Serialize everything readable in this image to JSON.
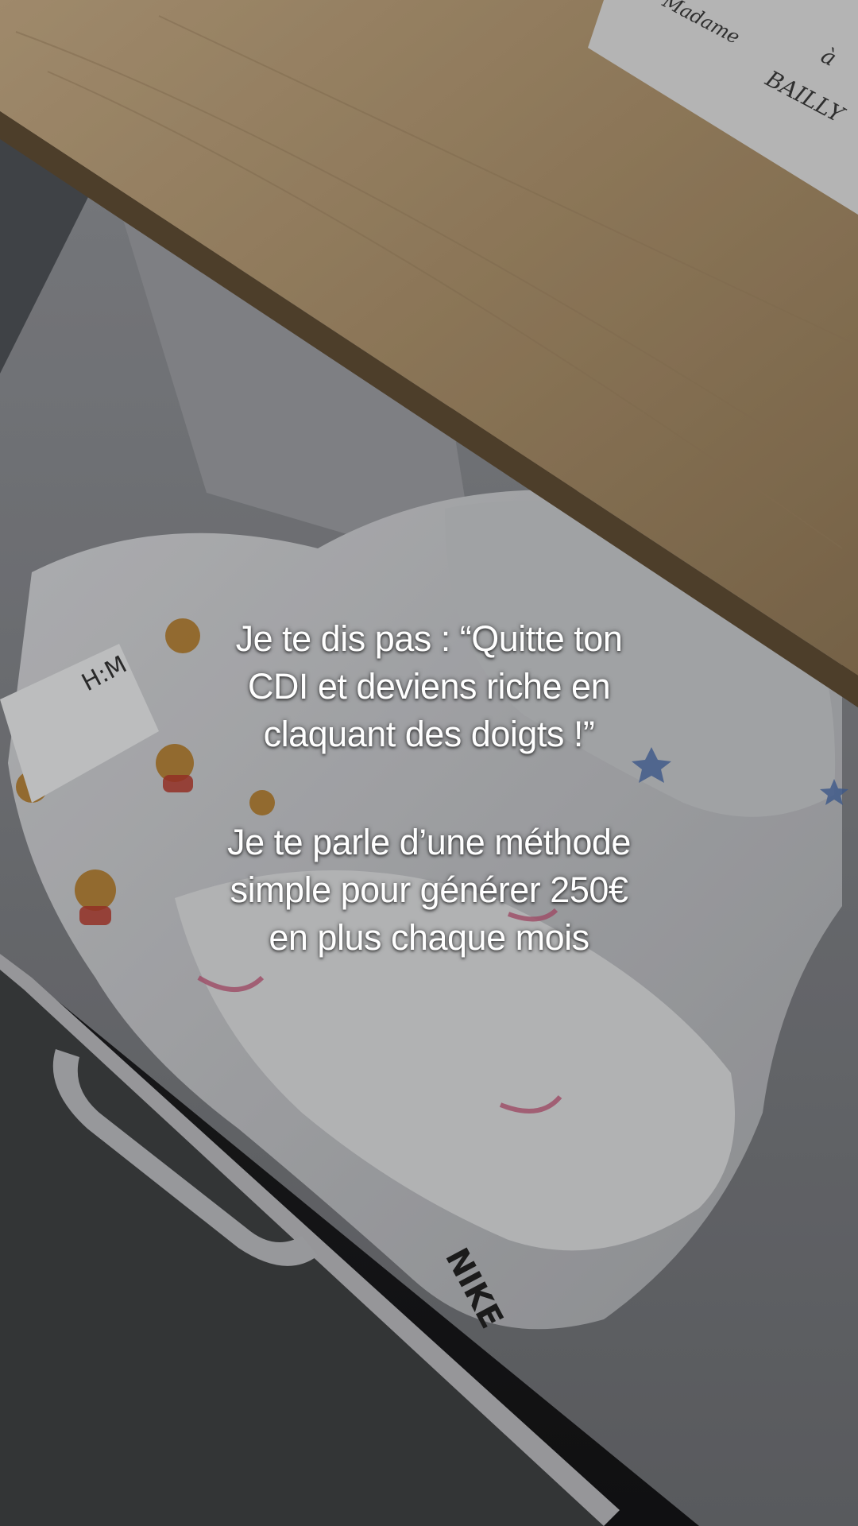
{
  "overlay": {
    "paragraph_1": {
      "lines": [
        "Je te dis pas : “Quitte ton",
        "CDI et deviens riche en",
        "claquant des doigts !”"
      ]
    },
    "paragraph_2": {
      "lines": [
        "Je te parle d’une méthode",
        "simple pour générer 250€",
        "en plus chaque mois"
      ]
    }
  },
  "background": {
    "note": {
      "line_1": "Madame",
      "line_2": "à",
      "line_3": "BAILLY"
    },
    "colors": {
      "wood": "#b59a72",
      "drawer_fabric": "#8d8f93",
      "clothes": "#c9cacc",
      "floor": "#1c1c1e"
    }
  }
}
